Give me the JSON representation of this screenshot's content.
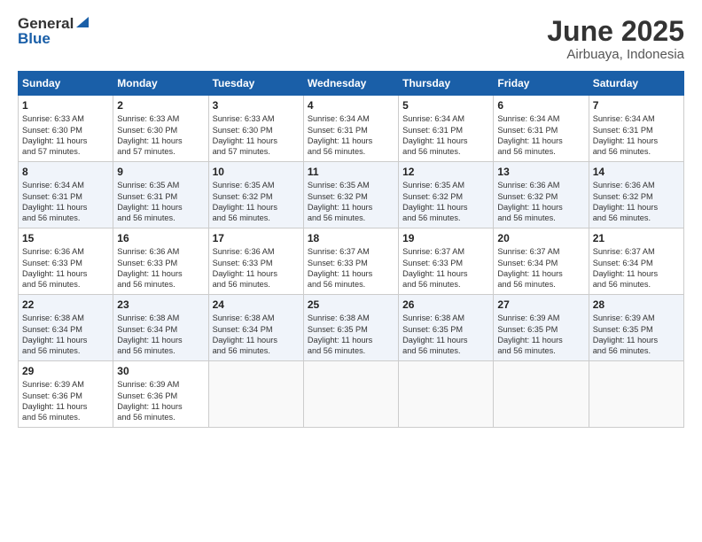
{
  "header": {
    "logo_general": "General",
    "logo_blue": "Blue",
    "month": "June 2025",
    "location": "Airbuaya, Indonesia"
  },
  "weekdays": [
    "Sunday",
    "Monday",
    "Tuesday",
    "Wednesday",
    "Thursday",
    "Friday",
    "Saturday"
  ],
  "weeks": [
    [
      {
        "day": "1",
        "info": "Sunrise: 6:33 AM\nSunset: 6:30 PM\nDaylight: 11 hours\nand 57 minutes."
      },
      {
        "day": "2",
        "info": "Sunrise: 6:33 AM\nSunset: 6:30 PM\nDaylight: 11 hours\nand 57 minutes."
      },
      {
        "day": "3",
        "info": "Sunrise: 6:33 AM\nSunset: 6:30 PM\nDaylight: 11 hours\nand 57 minutes."
      },
      {
        "day": "4",
        "info": "Sunrise: 6:34 AM\nSunset: 6:31 PM\nDaylight: 11 hours\nand 56 minutes."
      },
      {
        "day": "5",
        "info": "Sunrise: 6:34 AM\nSunset: 6:31 PM\nDaylight: 11 hours\nand 56 minutes."
      },
      {
        "day": "6",
        "info": "Sunrise: 6:34 AM\nSunset: 6:31 PM\nDaylight: 11 hours\nand 56 minutes."
      },
      {
        "day": "7",
        "info": "Sunrise: 6:34 AM\nSunset: 6:31 PM\nDaylight: 11 hours\nand 56 minutes."
      }
    ],
    [
      {
        "day": "8",
        "info": "Sunrise: 6:34 AM\nSunset: 6:31 PM\nDaylight: 11 hours\nand 56 minutes."
      },
      {
        "day": "9",
        "info": "Sunrise: 6:35 AM\nSunset: 6:31 PM\nDaylight: 11 hours\nand 56 minutes."
      },
      {
        "day": "10",
        "info": "Sunrise: 6:35 AM\nSunset: 6:32 PM\nDaylight: 11 hours\nand 56 minutes."
      },
      {
        "day": "11",
        "info": "Sunrise: 6:35 AM\nSunset: 6:32 PM\nDaylight: 11 hours\nand 56 minutes."
      },
      {
        "day": "12",
        "info": "Sunrise: 6:35 AM\nSunset: 6:32 PM\nDaylight: 11 hours\nand 56 minutes."
      },
      {
        "day": "13",
        "info": "Sunrise: 6:36 AM\nSunset: 6:32 PM\nDaylight: 11 hours\nand 56 minutes."
      },
      {
        "day": "14",
        "info": "Sunrise: 6:36 AM\nSunset: 6:32 PM\nDaylight: 11 hours\nand 56 minutes."
      }
    ],
    [
      {
        "day": "15",
        "info": "Sunrise: 6:36 AM\nSunset: 6:33 PM\nDaylight: 11 hours\nand 56 minutes."
      },
      {
        "day": "16",
        "info": "Sunrise: 6:36 AM\nSunset: 6:33 PM\nDaylight: 11 hours\nand 56 minutes."
      },
      {
        "day": "17",
        "info": "Sunrise: 6:36 AM\nSunset: 6:33 PM\nDaylight: 11 hours\nand 56 minutes."
      },
      {
        "day": "18",
        "info": "Sunrise: 6:37 AM\nSunset: 6:33 PM\nDaylight: 11 hours\nand 56 minutes."
      },
      {
        "day": "19",
        "info": "Sunrise: 6:37 AM\nSunset: 6:33 PM\nDaylight: 11 hours\nand 56 minutes."
      },
      {
        "day": "20",
        "info": "Sunrise: 6:37 AM\nSunset: 6:34 PM\nDaylight: 11 hours\nand 56 minutes."
      },
      {
        "day": "21",
        "info": "Sunrise: 6:37 AM\nSunset: 6:34 PM\nDaylight: 11 hours\nand 56 minutes."
      }
    ],
    [
      {
        "day": "22",
        "info": "Sunrise: 6:38 AM\nSunset: 6:34 PM\nDaylight: 11 hours\nand 56 minutes."
      },
      {
        "day": "23",
        "info": "Sunrise: 6:38 AM\nSunset: 6:34 PM\nDaylight: 11 hours\nand 56 minutes."
      },
      {
        "day": "24",
        "info": "Sunrise: 6:38 AM\nSunset: 6:34 PM\nDaylight: 11 hours\nand 56 minutes."
      },
      {
        "day": "25",
        "info": "Sunrise: 6:38 AM\nSunset: 6:35 PM\nDaylight: 11 hours\nand 56 minutes."
      },
      {
        "day": "26",
        "info": "Sunrise: 6:38 AM\nSunset: 6:35 PM\nDaylight: 11 hours\nand 56 minutes."
      },
      {
        "day": "27",
        "info": "Sunrise: 6:39 AM\nSunset: 6:35 PM\nDaylight: 11 hours\nand 56 minutes."
      },
      {
        "day": "28",
        "info": "Sunrise: 6:39 AM\nSunset: 6:35 PM\nDaylight: 11 hours\nand 56 minutes."
      }
    ],
    [
      {
        "day": "29",
        "info": "Sunrise: 6:39 AM\nSunset: 6:36 PM\nDaylight: 11 hours\nand 56 minutes."
      },
      {
        "day": "30",
        "info": "Sunrise: 6:39 AM\nSunset: 6:36 PM\nDaylight: 11 hours\nand 56 minutes."
      },
      {
        "day": "",
        "info": ""
      },
      {
        "day": "",
        "info": ""
      },
      {
        "day": "",
        "info": ""
      },
      {
        "day": "",
        "info": ""
      },
      {
        "day": "",
        "info": ""
      }
    ]
  ]
}
